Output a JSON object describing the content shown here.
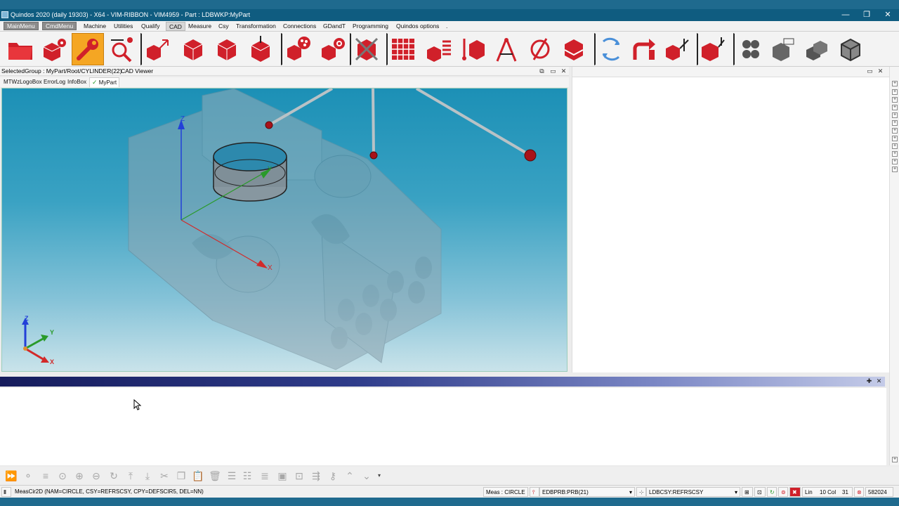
{
  "window": {
    "title": "Quindos 2020 (daily 19303) - X64 - VIM-RIBBON - VIM4959 - Part : LDBWKP:MyPart",
    "controls": [
      "—",
      "❐",
      "✕"
    ]
  },
  "menu": {
    "items": [
      {
        "label": "MainMenu",
        "style": "btn"
      },
      {
        "label": "CmdMenu",
        "style": "btn"
      },
      {
        "label": "Machine"
      },
      {
        "label": "Utilities"
      },
      {
        "label": "Qualify"
      },
      {
        "label": "CAD",
        "style": "active"
      },
      {
        "label": "Measure"
      },
      {
        "label": "Csy"
      },
      {
        "label": "Transformation"
      },
      {
        "label": "Connections"
      },
      {
        "label": "GDandT"
      },
      {
        "label": "Programming"
      },
      {
        "label": "Quindos options"
      },
      {
        "label": "."
      }
    ]
  },
  "ribbon": {
    "buttons": [
      {
        "icon": "folder-open-icon"
      },
      {
        "icon": "cube-gear-icon"
      },
      {
        "icon": "wrench-icon",
        "selected": true
      },
      {
        "icon": "magnify-search-icon"
      },
      {
        "icon": "cube-axes-icon"
      },
      {
        "icon": "cube-icon"
      },
      {
        "icon": "cube-icon"
      },
      {
        "icon": "cube-arrow-icon"
      },
      {
        "icon": "palette-cube-icon"
      },
      {
        "icon": "camera-cube-icon"
      },
      {
        "icon": "cube-delete-icon"
      },
      {
        "icon": "grid-icon"
      },
      {
        "icon": "cube-list-icon"
      },
      {
        "icon": "cube-pin-icon"
      },
      {
        "icon": "compass-icon"
      },
      {
        "icon": "diameter-icon"
      },
      {
        "icon": "cube-slice-icon"
      },
      {
        "icon": "rotate-arrows-icon"
      },
      {
        "icon": "turn-arrow-icon"
      },
      {
        "icon": "cube-csy-icon"
      },
      {
        "icon": "cube-csy-probe-icon"
      },
      {
        "icon": "hexagon-cluster-icon"
      },
      {
        "icon": "cube-outline-icon"
      },
      {
        "icon": "cube-stack-icon"
      },
      {
        "icon": "cube-wire-icon"
      }
    ]
  },
  "left_panel": {
    "header": "SelectedGroup : MyPart/Root/CYLINDER(22)",
    "viewer_title": "CAD Viewer",
    "tabs": [
      "MTWzLogoBox",
      "ErrorLog",
      "InfoBox",
      "MyPart"
    ],
    "active_tab": "MyPart"
  },
  "viewport": {
    "axis_labels": {
      "z": "Z",
      "y": "Y",
      "x": "X"
    },
    "triad_labels": {
      "z": "Z",
      "y": "Y",
      "x": "X"
    }
  },
  "bottom_toolbar": {
    "icons": [
      "play-forward-icon",
      "step-icon",
      "step-list-icon",
      "step-into-icon",
      "step-over-icon",
      "step-out-icon",
      "cycle-icon",
      "step-up-icon",
      "step-down-icon",
      "cut-icon",
      "copy-icon",
      "paste-icon",
      "delete-icon",
      "list-icon",
      "list-stack-icon",
      "lines-icon",
      "image-icon",
      "frame-icon",
      "wrap-icon",
      "key-icon",
      "up-icon",
      "down-icon",
      "dropdown-icon"
    ]
  },
  "status": {
    "command": "MeasCir2D  (NAM=CIRCLE, CSY=REFRSCSY, CPY=DEFSCIR5, DEL=NN)",
    "meas": "Meas : CIRCLE",
    "probe": "EDBPRB:PRB(21)",
    "csy": "LDBCSY:REFRSCSY",
    "line_label": "Lin",
    "line_value": "10 Col",
    "col_value": "31",
    "counter": "582024"
  },
  "colors": {
    "title_bar": "#0f5c80",
    "ribbon_selected": "#f5a623",
    "icon_red": "#d0202a",
    "viewport_top": "#1c90b6",
    "viewport_bottom": "#c9e3ea"
  }
}
